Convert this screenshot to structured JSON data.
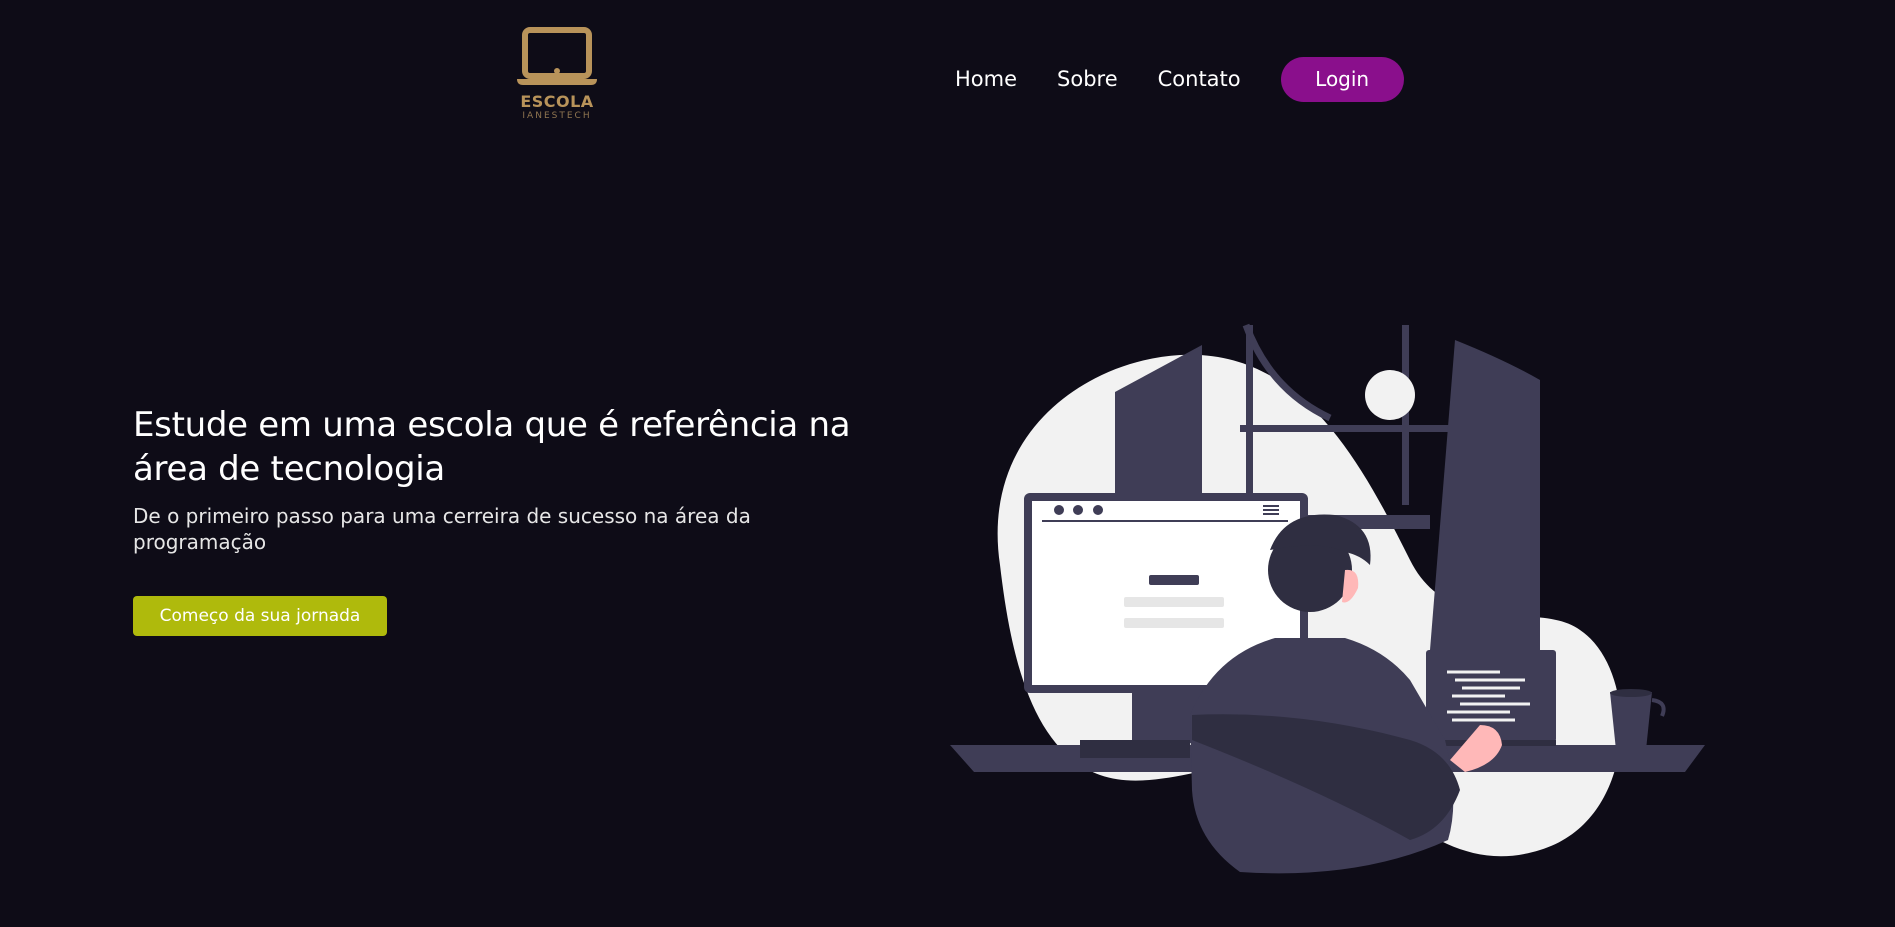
{
  "brand": {
    "name": "ESCOLA",
    "subtitle": "IANESTECH",
    "icon": "laptop-icon",
    "color": "#b8935a"
  },
  "nav": {
    "items": [
      {
        "label": "Home"
      },
      {
        "label": "Sobre"
      },
      {
        "label": "Contato"
      }
    ],
    "login_label": "Login",
    "login_color": "#8a0f8c"
  },
  "hero": {
    "title": "Estude em uma escola que é referência na área de tecnologia",
    "subtitle": "De o primeiro passo para uma cerreira de sucesso na área da programação",
    "cta_label": "Começo da sua jornada",
    "cta_color": "#afba0c"
  },
  "illustration": {
    "name": "person-at-computer-illustration"
  },
  "colors": {
    "background": "#0e0c17",
    "text": "#ffffff"
  }
}
